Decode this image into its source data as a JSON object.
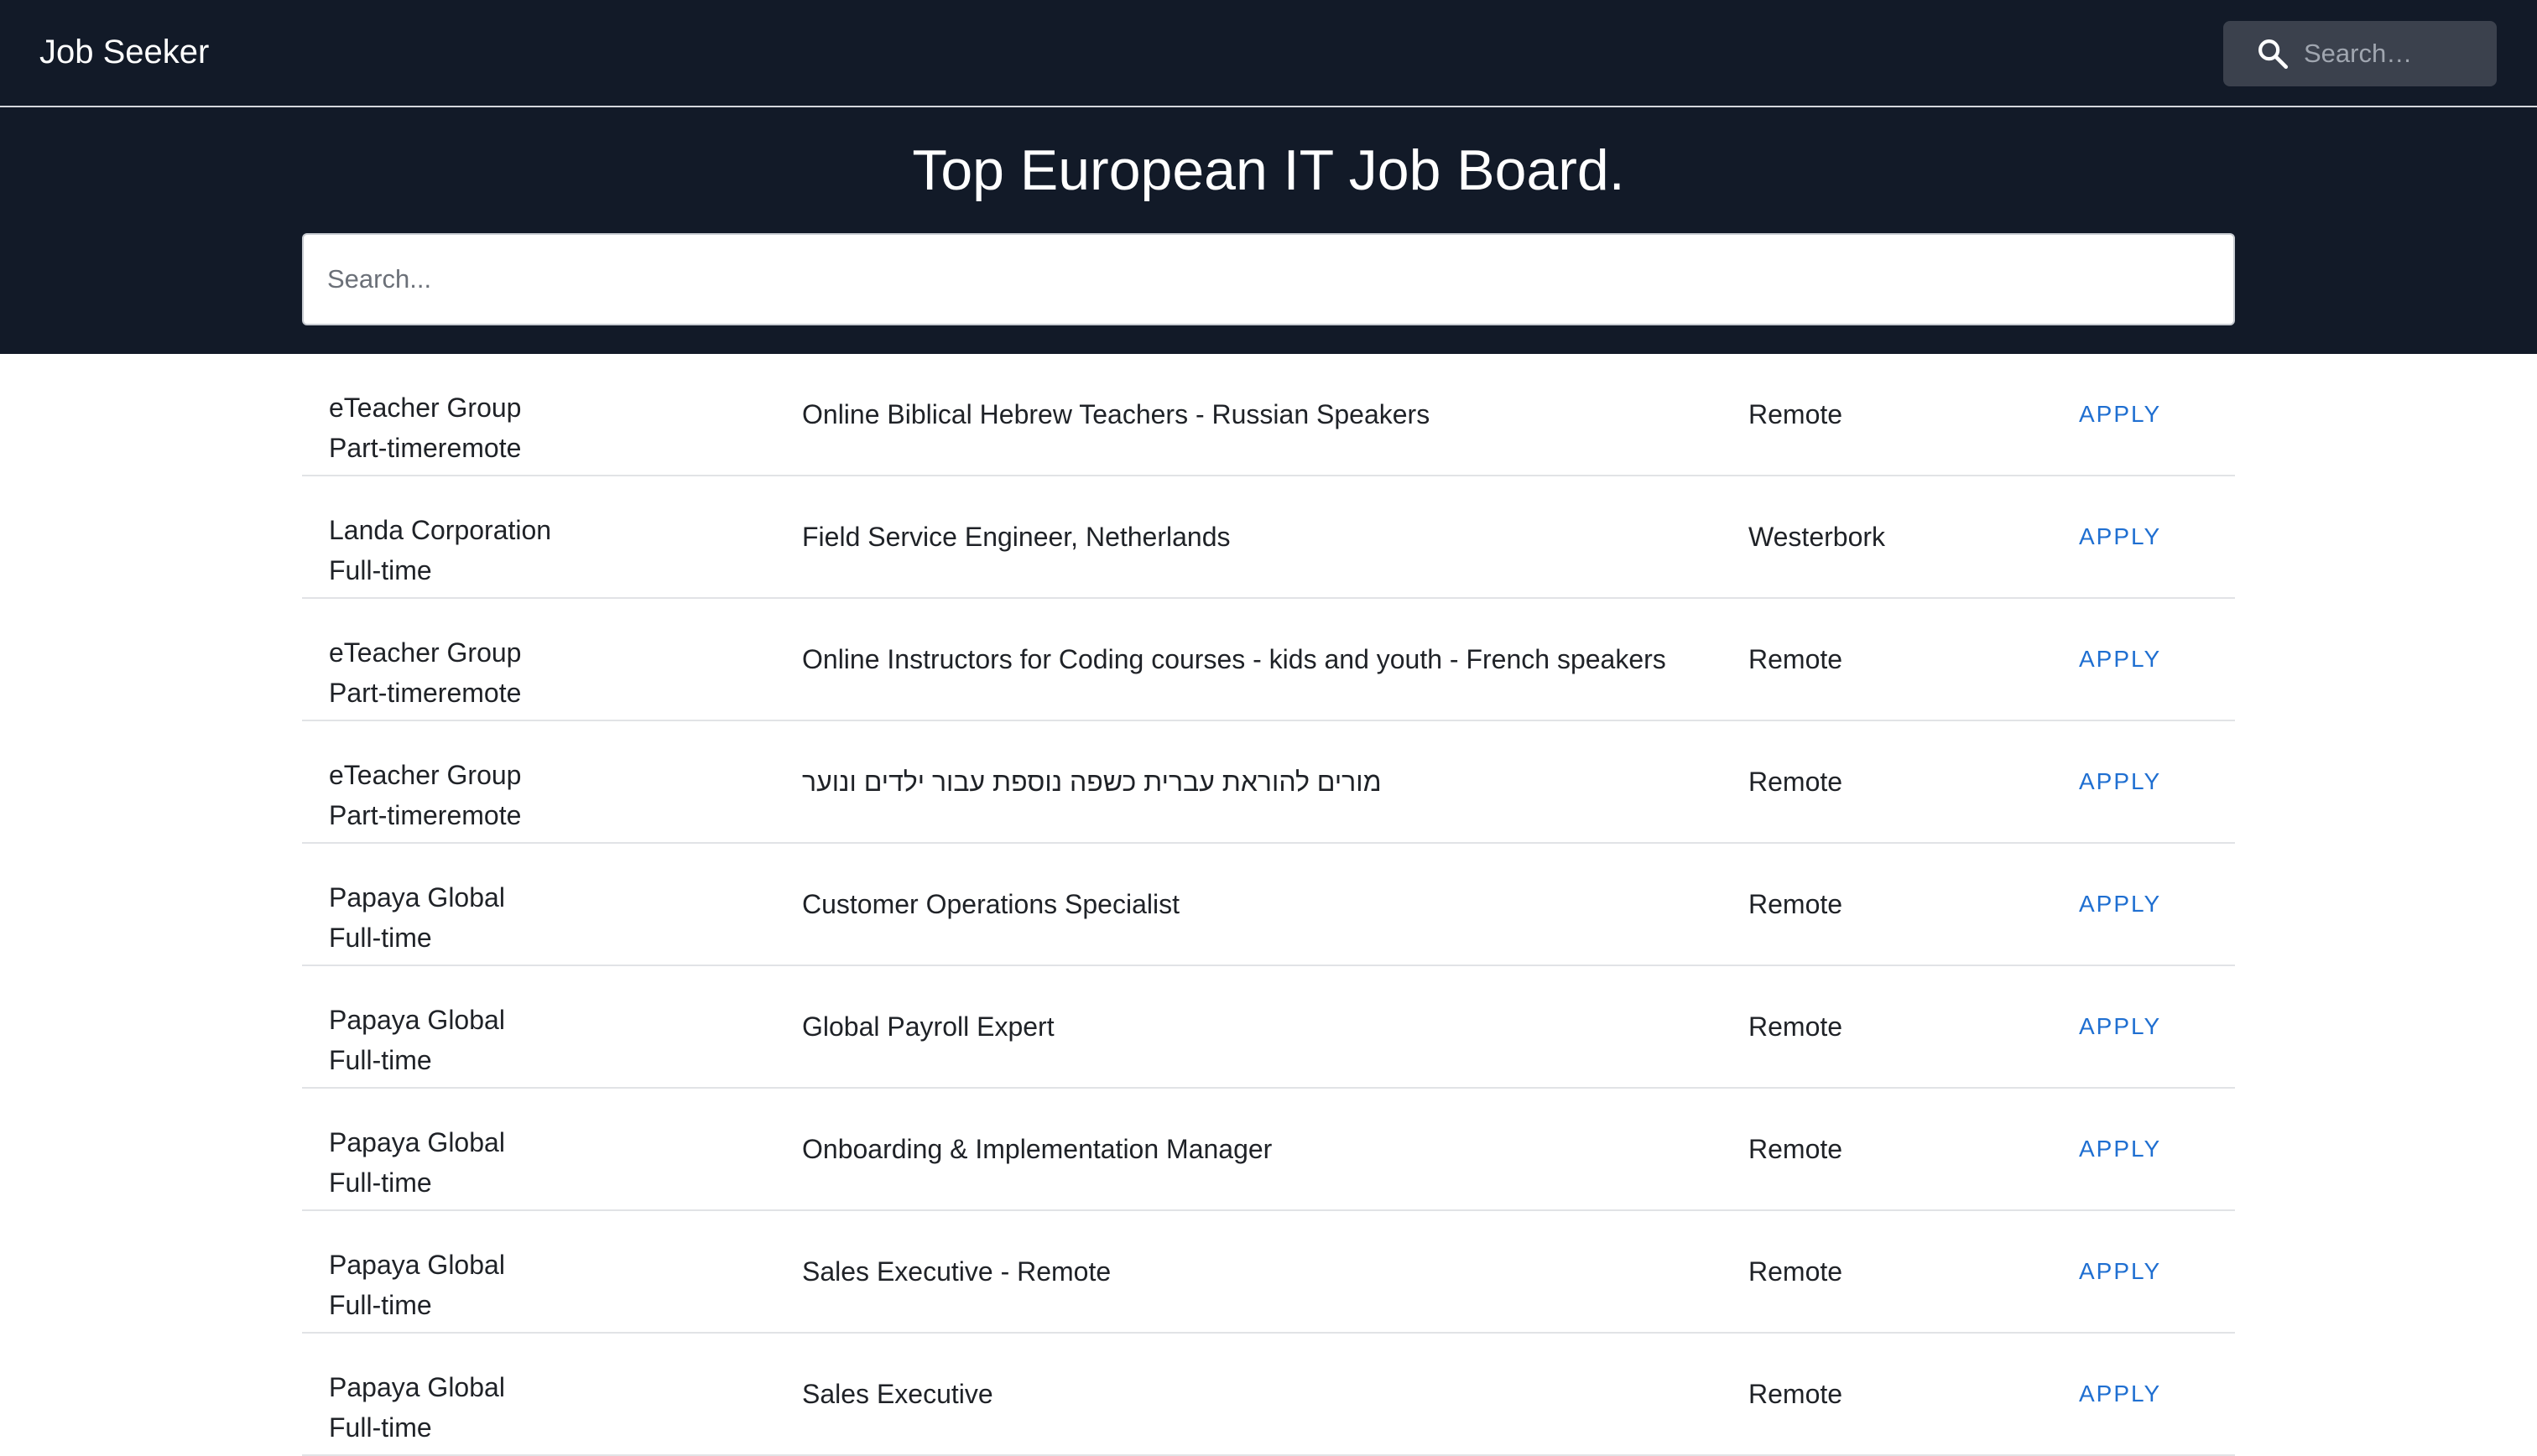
{
  "appbar": {
    "brand": "Job Seeker",
    "search": {
      "placeholder": "Search…",
      "icon": "search-icon"
    }
  },
  "hero": {
    "title": "Top European IT Job Board.",
    "search_placeholder": "Search..."
  },
  "jobs": [
    {
      "company": "eTeacher Group",
      "type": "Part-timeremote",
      "title": "Online Biblical Hebrew Teachers - Russian Speakers",
      "location": "Remote",
      "action": "APPLY"
    },
    {
      "company": "Landa Corporation",
      "type": "Full-time",
      "title": "Field Service Engineer, Netherlands",
      "location": "Westerbork",
      "action": "APPLY"
    },
    {
      "company": "eTeacher Group",
      "type": "Part-timeremote",
      "title": "Online Instructors for Coding courses - kids and youth - French speakers",
      "location": "Remote",
      "action": "APPLY"
    },
    {
      "company": "eTeacher Group",
      "type": "Part-timeremote",
      "title": "מורים להוראת עברית כשפה נוספת עבור ילדים ונוער",
      "location": "Remote",
      "action": "APPLY"
    },
    {
      "company": "Papaya Global",
      "type": "Full-time",
      "title": "Customer Operations Specialist",
      "location": "Remote",
      "action": "APPLY"
    },
    {
      "company": "Papaya Global",
      "type": "Full-time",
      "title": "Global Payroll Expert",
      "location": "Remote",
      "action": "APPLY"
    },
    {
      "company": "Papaya Global",
      "type": "Full-time",
      "title": "Onboarding & Implementation Manager",
      "location": "Remote",
      "action": "APPLY"
    },
    {
      "company": "Papaya Global",
      "type": "Full-time",
      "title": "Sales Executive - Remote",
      "location": "Remote",
      "action": "APPLY"
    },
    {
      "company": "Papaya Global",
      "type": "Full-time",
      "title": "Sales Executive",
      "location": "Remote",
      "action": "APPLY"
    }
  ],
  "colors": {
    "header_bg": "#121a28",
    "accent": "#1f6fd1",
    "nav_search_bg": "#3b414d"
  }
}
